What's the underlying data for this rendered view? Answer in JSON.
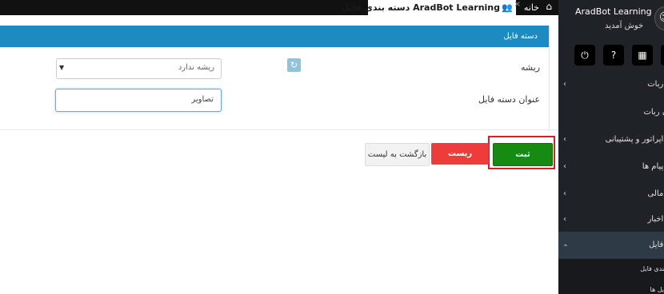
{
  "tabs": {
    "active_label": "AradBot Learning  دسته بندی فایل",
    "home_label": "خانه",
    "close_glyph": "×"
  },
  "panel": {
    "title": "دسته فایل",
    "root_label": "ریشه",
    "root_select_value": "ریشه ندارد",
    "title_label": "عنوان دسته فایل",
    "title_input_value": "تصاویر"
  },
  "buttons": {
    "submit": "ثبت",
    "reset": "ریست",
    "back": "بازگشت به لیست"
  },
  "sidebar": {
    "app_title": "AradBot Learning",
    "welcome": "خوش آمدید",
    "menu": [
      {
        "label": "مدیریت ربات"
      },
      {
        "label": "عنوان ربات"
      },
      {
        "label": "مدیریت اپراتور و پشتیبانی"
      },
      {
        "label": "مدیریت پیام ها"
      },
      {
        "label": "مدیریت مالی"
      },
      {
        "label": "مدیریت اخبار"
      },
      {
        "label": "مدیریت فایل"
      }
    ],
    "submenu": [
      {
        "label": "دسته بندی فایل"
      },
      {
        "label": "مدیریت فایل ها"
      }
    ]
  },
  "colors": {
    "header_blue": "#1b8bc1",
    "submit_green": "#168a13",
    "reset_red": "#ef3b3a",
    "highlight_red": "#d62027",
    "sidebar_bg": "#1f2226"
  }
}
